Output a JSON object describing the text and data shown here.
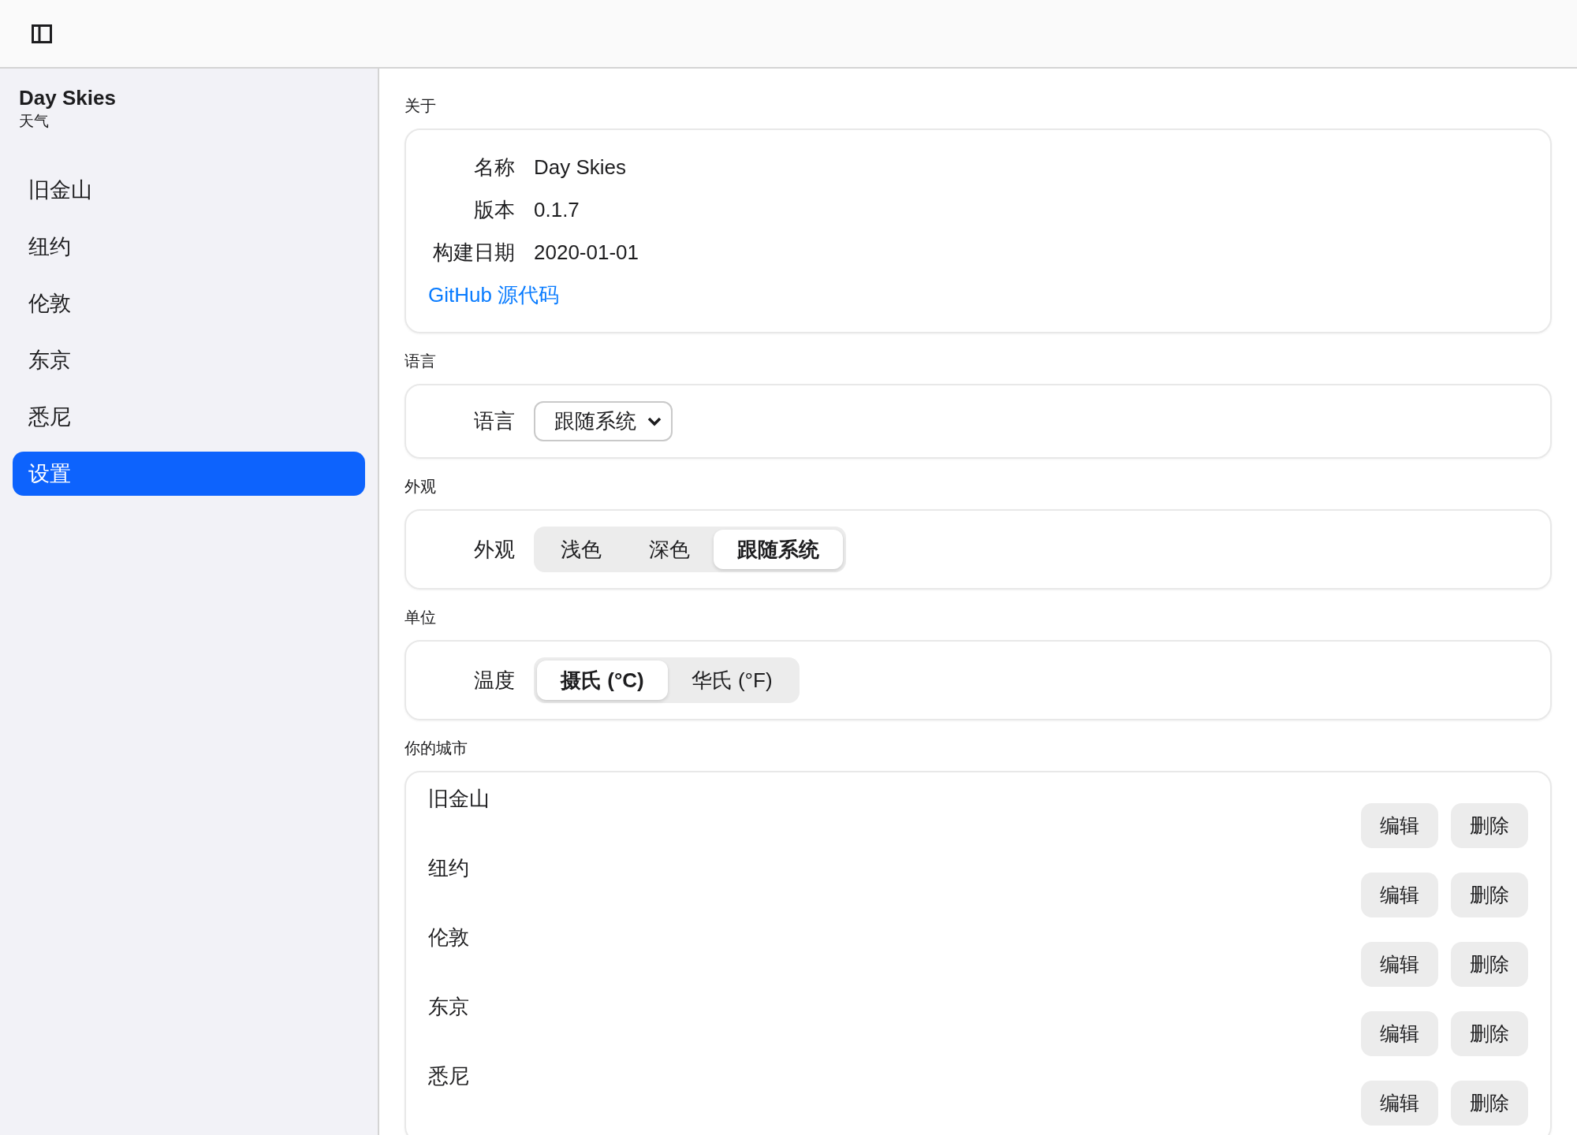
{
  "sidebar": {
    "title": "Day Skies",
    "subtitle": "天气",
    "items": [
      {
        "label": "旧金山",
        "selected": false
      },
      {
        "label": "纽约",
        "selected": false
      },
      {
        "label": "伦敦",
        "selected": false
      },
      {
        "label": "东京",
        "selected": false
      },
      {
        "label": "悉尼",
        "selected": false
      },
      {
        "label": "设置",
        "selected": true
      }
    ]
  },
  "sections": [
    {
      "kind": "about",
      "heading": "关于",
      "rows": [
        {
          "label": "名称",
          "value": "Day Skies"
        },
        {
          "label": "版本",
          "value": "0.1.7"
        },
        {
          "label": "构建日期",
          "value": "2020-01-01"
        }
      ],
      "link": "GitHub 源代码"
    },
    {
      "kind": "select",
      "heading": "语言",
      "label": "语言",
      "value": "跟随系统"
    },
    {
      "kind": "segmented",
      "heading": "外观",
      "label": "外观",
      "options": [
        {
          "label": "浅色",
          "selected": false
        },
        {
          "label": "深色",
          "selected": false
        },
        {
          "label": "跟随系统",
          "selected": true
        }
      ]
    },
    {
      "kind": "segmented",
      "heading": "单位",
      "label": "温度",
      "options": [
        {
          "label": "摄氏 (°C)",
          "selected": true
        },
        {
          "label": "华氏 (°F)",
          "selected": false
        }
      ]
    },
    {
      "kind": "cities",
      "heading": "你的城市",
      "cities": [
        {
          "name": "旧金山",
          "buttons": [
            "编辑",
            "删除"
          ]
        },
        {
          "name": "纽约",
          "buttons": [
            "编辑",
            "删除"
          ]
        },
        {
          "name": "伦敦",
          "buttons": [
            "编辑",
            "删除"
          ]
        },
        {
          "name": "东京",
          "buttons": [
            "编辑",
            "删除"
          ]
        },
        {
          "name": "悉尼",
          "buttons": [
            "编辑",
            "删除"
          ]
        }
      ]
    }
  ]
}
